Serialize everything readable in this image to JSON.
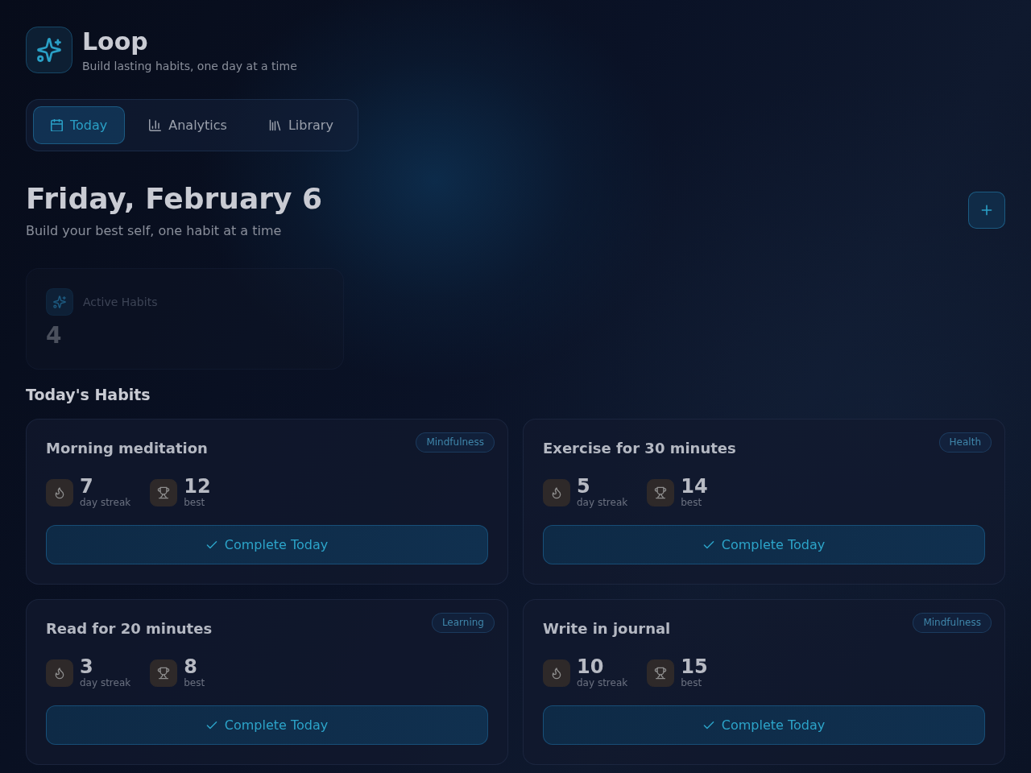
{
  "app": {
    "name": "Loop",
    "tagline": "Build lasting habits, one day at a time"
  },
  "tabs": [
    {
      "label": "Today",
      "selected": true
    },
    {
      "label": "Analytics",
      "selected": false
    },
    {
      "label": "Library",
      "selected": false
    }
  ],
  "page": {
    "title": "Friday, February 6",
    "subtitle": "Build your best self, one habit at a time"
  },
  "stats": [
    {
      "label": "Active Habits",
      "value": "4"
    }
  ],
  "habits_section": {
    "title": "Today's Habits",
    "habits": [
      {
        "name": "Morning meditation",
        "category": "Mindfulness",
        "stats": [
          {
            "kind": "streak",
            "value": "7",
            "label": "day streak"
          },
          {
            "kind": "best",
            "value": "12",
            "label": "best"
          }
        ],
        "action": "Complete Today"
      },
      {
        "name": "Exercise for 30 minutes",
        "category": "Health",
        "stats": [
          {
            "kind": "streak",
            "value": "5",
            "label": "day streak"
          },
          {
            "kind": "best",
            "value": "14",
            "label": "best"
          }
        ],
        "action": "Complete Today"
      },
      {
        "name": "Read for 20 minutes",
        "category": "Learning",
        "stats": [
          {
            "kind": "streak",
            "value": "3",
            "label": "day streak"
          },
          {
            "kind": "best",
            "value": "8",
            "label": "best"
          }
        ],
        "action": "Complete Today"
      },
      {
        "name": "Write in journal",
        "category": "Mindfulness",
        "stats": [
          {
            "kind": "streak",
            "value": "10",
            "label": "day streak"
          },
          {
            "kind": "best",
            "value": "15",
            "label": "best"
          }
        ],
        "action": "Complete Today"
      }
    ]
  }
}
